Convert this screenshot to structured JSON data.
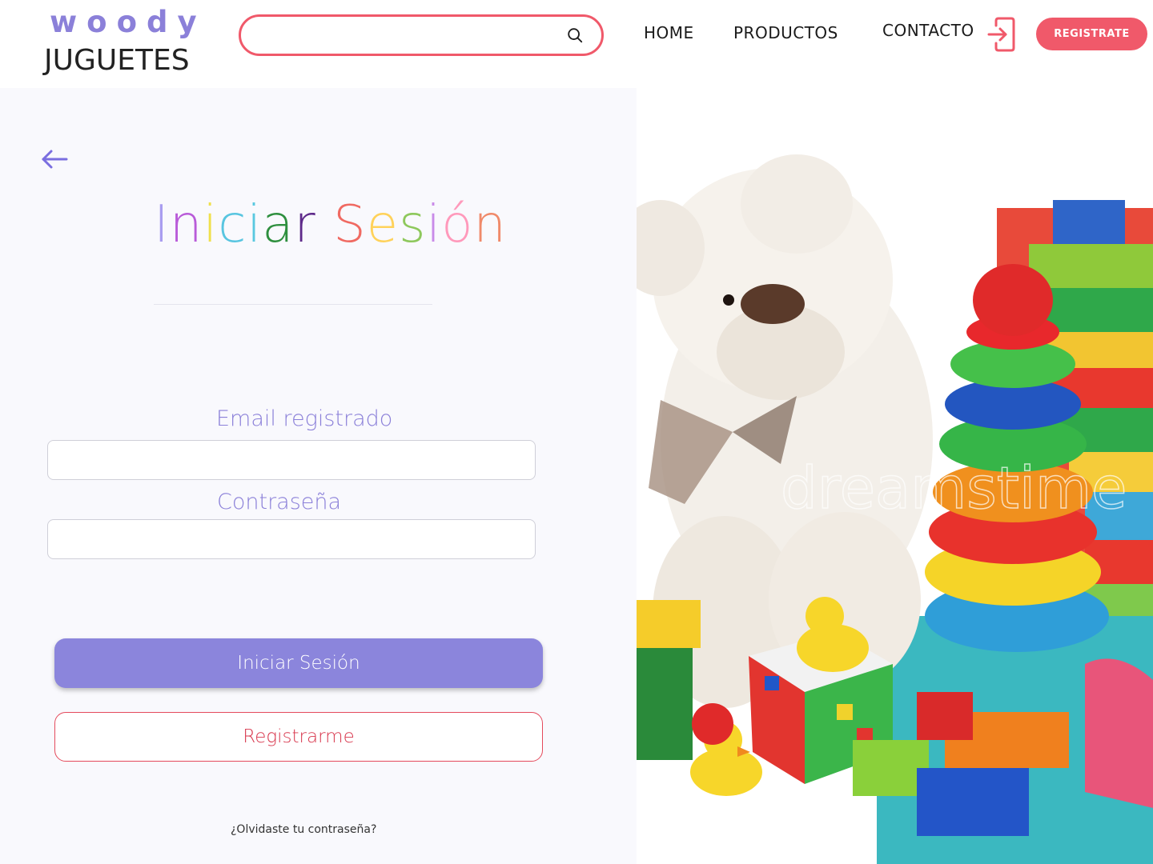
{
  "header": {
    "logo_top": "woody",
    "logo_bottom": "JUGUETES",
    "search": {
      "placeholder": "",
      "value": "",
      "icon": "search-icon"
    },
    "nav": {
      "home": "HOME",
      "productos": "PRODUCTOS",
      "contacto": "CONTACTO"
    },
    "login_icon": "login-icon",
    "register_button": "REGISTRATE"
  },
  "login": {
    "back_icon": "arrow-left-icon",
    "title_part1": "Iniciar",
    "title_part2": "Sesión",
    "email_label": "Email registrado",
    "email_value": "",
    "password_label": "Contraseña",
    "password_value": "",
    "login_button": "Iniciar Sesión",
    "register_button": "Registrarme",
    "forgot_link": "¿Olvidaste tu contraseña?"
  },
  "hero": {
    "watermark": "dreamstime"
  },
  "colors": {
    "brand_purple": "#8b80d9",
    "brand_red": "#f0596a",
    "login_button_bg": "#8b85dc",
    "panel_bg": "#f9f9fd",
    "title_letters": [
      "#a99df0",
      "#b95bd9",
      "#f0e04c",
      "#58c5e0",
      "#5ac8e0",
      "#2e8f3e",
      "#5e2a8a",
      "#f06a62",
      "#ffd25a",
      "#8ec85c",
      "#c98be8",
      "#ff99bb",
      "#f08a6a",
      "#f59a7a"
    ]
  }
}
